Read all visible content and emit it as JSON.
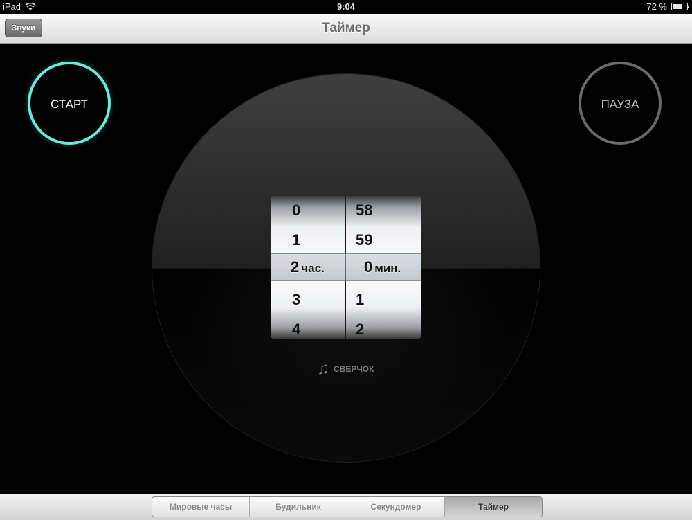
{
  "status_bar": {
    "device": "iPad",
    "time": "9:04",
    "battery": "72 %",
    "battery_level": 0.72
  },
  "nav": {
    "title": "Таймер",
    "sounds_button": "Звуки"
  },
  "controls": {
    "start": "СТАРТ",
    "pause": "ПАУЗА",
    "start_color": "#6ee8d8"
  },
  "picker": {
    "hours": [
      "0",
      "1",
      "2",
      "3",
      "4"
    ],
    "minutes": [
      "58",
      "59",
      "0",
      "1",
      "2"
    ],
    "selected_hours": "2",
    "selected_minutes": "0",
    "hours_unit": "час.",
    "minutes_unit": "мин."
  },
  "sound": {
    "icon": "music-note-icon",
    "label": "СВЕРЧОК"
  },
  "tabs": [
    {
      "label": "Мировые часы",
      "active": false
    },
    {
      "label": "Будильник",
      "active": false
    },
    {
      "label": "Секундомер",
      "active": false
    },
    {
      "label": "Таймер",
      "active": true
    }
  ]
}
